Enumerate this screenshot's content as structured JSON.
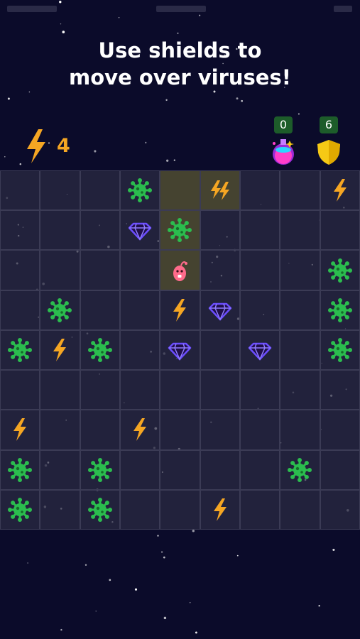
{
  "instruction": {
    "line1": "Use shields to",
    "line2": "move over viruses!"
  },
  "hud": {
    "energy_count": "4",
    "potion_count": "0",
    "shield_count": "6",
    "energy_icon": "lightning-bolt-icon",
    "potion_icon": "potion-flask-icon",
    "shield_icon": "shield-icon"
  },
  "colors": {
    "background": "#0b0b2a",
    "cell": "#2b2b44",
    "cell_border": "#3b3b55",
    "path_cell": "#454330",
    "virus": "#2bbd4e",
    "energy": "#f5a623",
    "diamond": "#6b4dff",
    "player": "#ff6b8b",
    "badge": "#1d5c2a",
    "shield": "#f6c915"
  },
  "board": {
    "legend": {
      "V": "virus",
      "E": "energy bolt",
      "D": "double energy bolt",
      "G": "diamond",
      "P": "player",
      ".": "empty"
    },
    "path": [
      "0,4",
      "0,5",
      "1,4",
      "2,4"
    ],
    "rows": [
      [
        ".",
        ".",
        ".",
        "V",
        ".",
        "D",
        ".",
        ".",
        "E"
      ],
      [
        ".",
        ".",
        ".",
        "G",
        "V",
        ".",
        ".",
        ".",
        "."
      ],
      [
        ".",
        ".",
        ".",
        ".",
        "P",
        ".",
        ".",
        ".",
        "V"
      ],
      [
        ".",
        "V",
        ".",
        ".",
        "E",
        "G",
        ".",
        ".",
        "V"
      ],
      [
        "V",
        "E",
        "V",
        ".",
        "G",
        ".",
        "G",
        ".",
        "V"
      ],
      [
        ".",
        ".",
        ".",
        ".",
        ".",
        ".",
        ".",
        ".",
        "."
      ],
      [
        "E",
        ".",
        ".",
        "E",
        ".",
        ".",
        ".",
        ".",
        "."
      ],
      [
        "V",
        ".",
        "V",
        ".",
        ".",
        ".",
        ".",
        "V",
        "."
      ],
      [
        "V",
        ".",
        "V",
        ".",
        ".",
        "E",
        ".",
        ".",
        "."
      ]
    ]
  }
}
